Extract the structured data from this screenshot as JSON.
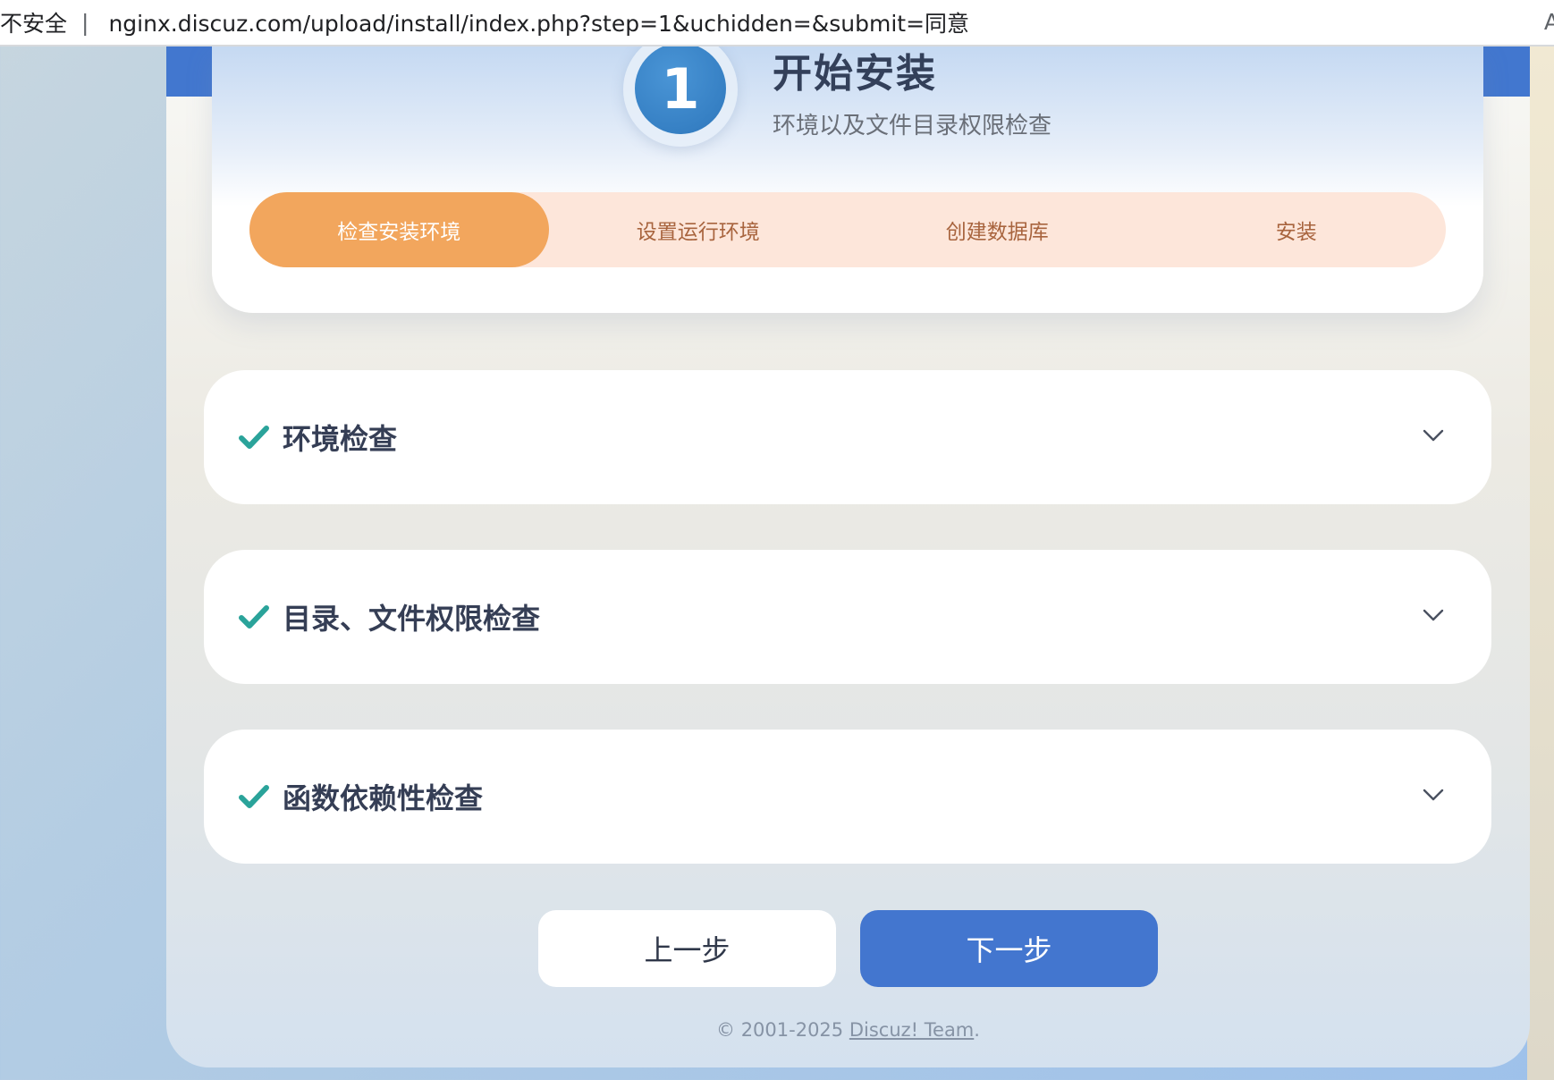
{
  "browser": {
    "security_label": "不安全",
    "separator": "|",
    "url": "nginx.discuz.com/upload/install/index.php?step=1&uchidden=&submit=同意",
    "right_glyph": "A"
  },
  "header": {
    "step_number": "1",
    "title": "开始安装",
    "subtitle": "环境以及文件目录权限检查"
  },
  "progress": {
    "tabs": [
      {
        "label": "检查安装环境",
        "active": true
      },
      {
        "label": "设置运行环境",
        "active": false
      },
      {
        "label": "创建数据库",
        "active": false
      },
      {
        "label": "安装",
        "active": false
      }
    ]
  },
  "sections": [
    {
      "label": "环境检查",
      "status": "passed",
      "expanded": false
    },
    {
      "label": "目录、文件权限检查",
      "status": "passed",
      "expanded": false
    },
    {
      "label": "函数依赖性检查",
      "status": "passed",
      "expanded": false
    }
  ],
  "buttons": {
    "prev_label": "上一步",
    "next_label": "下一步"
  },
  "footer": {
    "copyright": "© 2001-2025 ",
    "team_link": "Discuz! Team",
    "period": "."
  },
  "colors": {
    "accent_blue": "#4376cf",
    "active_tab": "#f2a65d",
    "inactive_tab_bg": "#fde6da",
    "check_teal": "#2aa39a"
  },
  "icons": {
    "check": "check-icon",
    "chevron": "chevron-down-icon"
  }
}
